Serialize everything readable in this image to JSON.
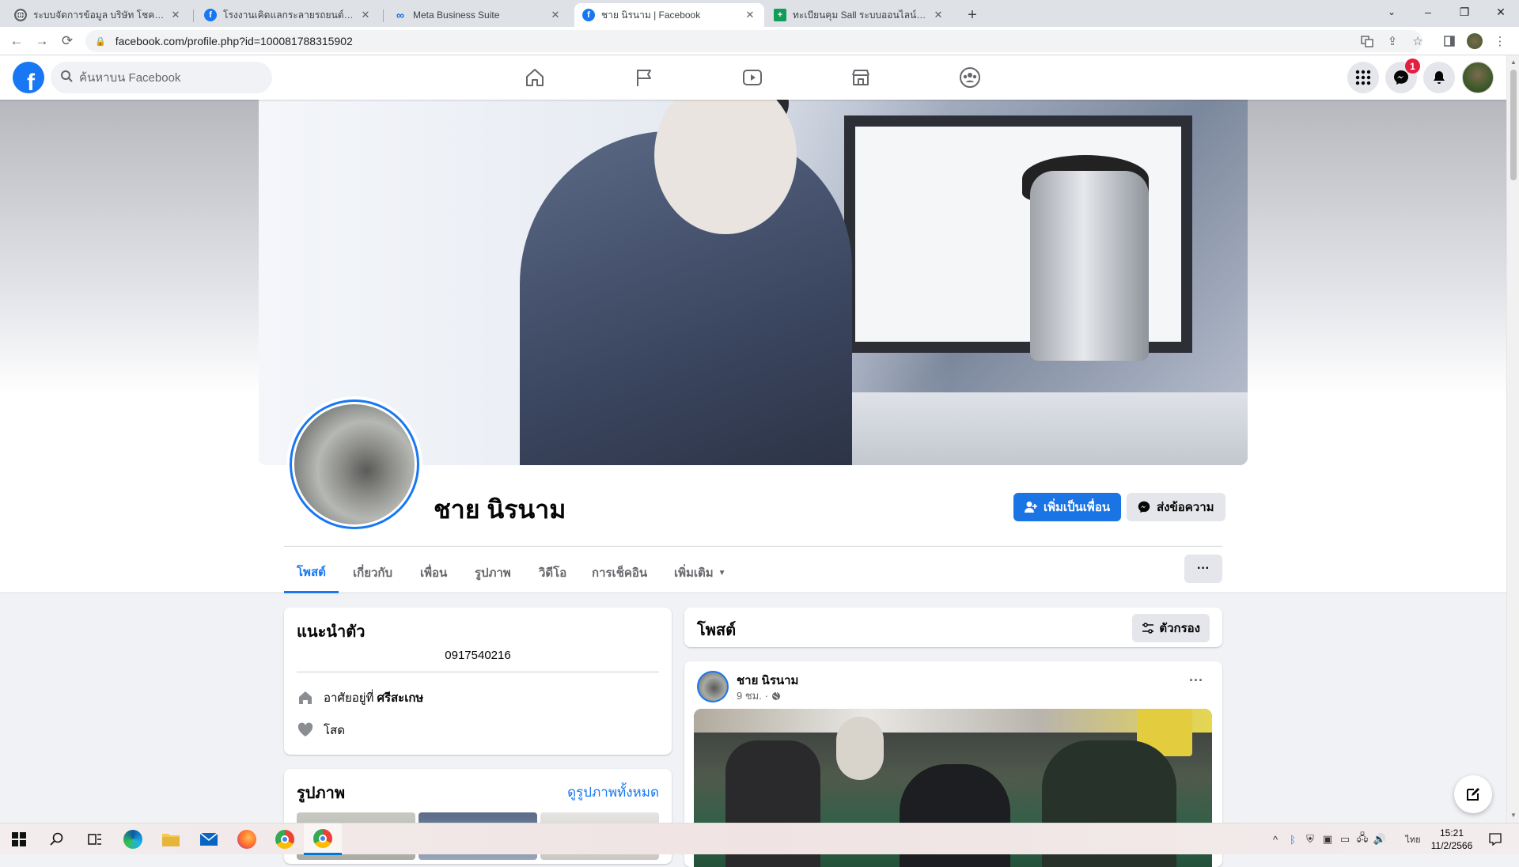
{
  "browser": {
    "tabs": [
      {
        "title": "ระบบจัดการข้อมูล บริษัท โชคลูกน็อต",
        "icon": "globe-icon"
      },
      {
        "title": "โรงงานเคิดแลกระลายรถยนต์ไข่เค้า",
        "icon": "facebook-icon"
      },
      {
        "title": "Meta Business Suite",
        "icon": "meta-icon"
      },
      {
        "title": "ชาย นิรนาม | Facebook",
        "icon": "facebook-icon"
      },
      {
        "title": "ทะเบียนคุม Sall ระบบออนไลน์.xlsx - G",
        "icon": "sheets-icon"
      }
    ],
    "url": "facebook.com/profile.php?id=100081788315902"
  },
  "facebook": {
    "search_placeholder": "ค้นหาบน Facebook",
    "message_badge": "1"
  },
  "profile": {
    "name": "ชาย นิรนาม",
    "add_friend_label": "เพิ่มเป็นเพื่อน",
    "message_label": "ส่งข้อความ",
    "tabs": [
      "โพสต์",
      "เกี่ยวกับ",
      "เพื่อน",
      "รูปภาพ",
      "วิดีโอ",
      "การเช็คอิน",
      "เพิ่มเติม"
    ],
    "more_dots": "···"
  },
  "intro": {
    "title": "แนะนำตัว",
    "bio": "0917540216",
    "lives_prefix": "อาศัยอยู่ที่",
    "lives_place": "ศรีสะเกษ",
    "relationship": "โสด"
  },
  "photos": {
    "title": "รูปภาพ",
    "see_all": "ดูรูปภาพทั้งหมด"
  },
  "posts": {
    "title": "โพสต์",
    "filter_label": "ตัวกรอง",
    "items": [
      {
        "author": "ชาย นิรนาม",
        "time": "9 ชม. ·",
        "more": "···"
      }
    ]
  },
  "taskbar": {
    "lang": "ไทย",
    "time": "15:21",
    "date": "11/2/2566"
  },
  "colors": {
    "fb_blue": "#1877f2",
    "button_blue": "#1b74e4",
    "badge_red": "#e41e3f"
  }
}
